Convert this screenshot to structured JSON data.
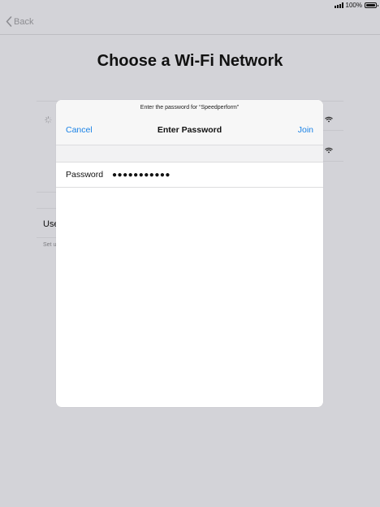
{
  "status_bar": {
    "battery_percent": "100%",
    "battery_level": 1.0
  },
  "nav": {
    "back_label": "Back"
  },
  "page": {
    "title": "Choose a Wi-Fi Network",
    "use_label": "Use",
    "setup_label": "Set u"
  },
  "modal": {
    "prompt": "Enter the password for “Speedperform”",
    "cancel_label": "Cancel",
    "title": "Enter Password",
    "join_label": "Join",
    "password_label": "Password",
    "password_value": "●●●●●●●●●●●"
  },
  "colors": {
    "accent": "#1a82e6",
    "background_dim": "#d3d3d8",
    "modal_bg": "#ffffff"
  },
  "icons": {
    "back": "chevron-left-icon",
    "wifi": "wifi-icon",
    "spinner": "loading-spinner-icon",
    "signal": "cellular-signal-icon",
    "battery": "battery-icon"
  }
}
